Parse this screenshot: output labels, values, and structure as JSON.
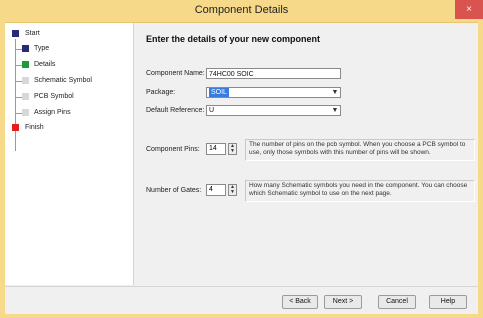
{
  "window": {
    "title": "Component Details",
    "close_glyph": "×"
  },
  "wizard": {
    "steps": [
      {
        "label": "Start",
        "color": "#2a2a7a"
      },
      {
        "label": "Type",
        "color": "#2a2a7a"
      },
      {
        "label": "Details",
        "color": "#1f9a3a"
      },
      {
        "label": "Schematic Symbol",
        "color": "#d8d8d8"
      },
      {
        "label": "PCB Symbol",
        "color": "#d8d8d8"
      },
      {
        "label": "Assign Pins",
        "color": "#d8d8d8"
      },
      {
        "label": "Finish",
        "color": "#e02020"
      }
    ]
  },
  "form": {
    "heading": "Enter the details of your new component",
    "component_name": {
      "label": "Component Name:",
      "value": "74HC00 SOIC"
    },
    "package": {
      "label": "Package:",
      "value": "SOIL"
    },
    "default_reference": {
      "label": "Default Reference:",
      "value": "U"
    },
    "component_pins": {
      "label": "Component Pins:",
      "value": "14",
      "hint": "The number of pins on the pcb symbol. When you choose a PCB symbol to use, only those symbols with this number of pins will be shown."
    },
    "number_of_gates": {
      "label": "Number of Gates:",
      "value": "4",
      "hint": "How many Schematic symbols you need in the component. You can choose which Schematic symbol to use on the next page."
    }
  },
  "footer": {
    "back": "< Back",
    "next": "Next >",
    "cancel": "Cancel",
    "help": "Help"
  }
}
